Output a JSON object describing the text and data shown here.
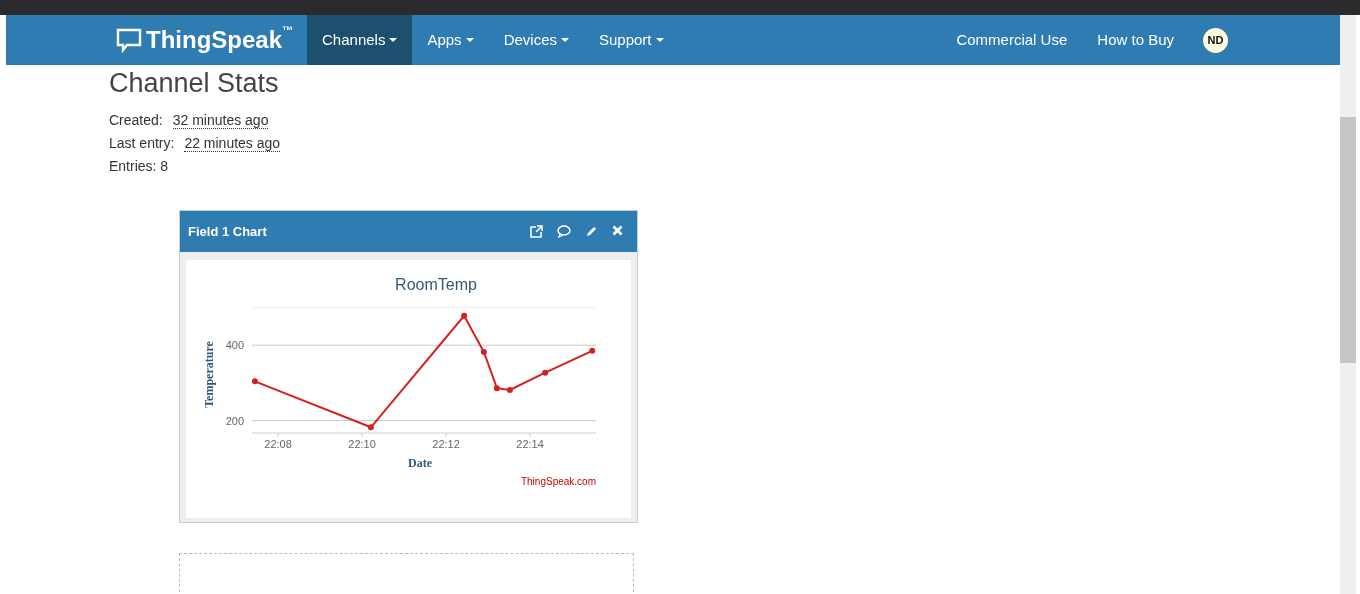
{
  "navbar": {
    "brand": "ThingSpeak",
    "trademark": "™",
    "menus": [
      {
        "label": "Channels",
        "selected": true,
        "kind": "dropdown"
      },
      {
        "label": "Apps",
        "selected": false,
        "kind": "dropdown"
      },
      {
        "label": "Devices",
        "selected": false,
        "kind": "dropdown"
      },
      {
        "label": "Support",
        "selected": false,
        "kind": "dropdown"
      }
    ],
    "links": [
      "Commercial Use",
      "How to Buy"
    ],
    "avatar": "ND"
  },
  "stats": {
    "title": "Channel Stats",
    "rows": [
      {
        "label": "Created:",
        "value": "32 minutes ago"
      },
      {
        "label": "Last entry:",
        "value": "22 minutes ago"
      },
      {
        "label": "Entries: 8"
      }
    ]
  },
  "widget": {
    "title": "Field 1 Chart",
    "chart_data": {
      "type": "line",
      "title": "RoomTemp",
      "xlabel": "Date",
      "ylabel": "Temperature",
      "x": [
        1327.45,
        1330.21,
        1332.43,
        1332.9,
        1333.21,
        1333.52,
        1334.36,
        1335.48
      ],
      "series": [
        {
          "color": "#d62020",
          "marker": "circle",
          "values": [
            304,
            182,
            478,
            382,
            286,
            281,
            327,
            385
          ]
        }
      ],
      "xlim": [
        1327.38,
        1335.57
      ],
      "ylim": [
        167,
        500
      ],
      "xticks": [
        {
          "value": 1328,
          "label": "22:08"
        },
        {
          "value": 1330,
          "label": "22:10"
        },
        {
          "value": 1332,
          "label": "22:12"
        },
        {
          "value": 1334,
          "label": "22:14"
        }
      ],
      "yticks": [
        200,
        400
      ]
    },
    "credit": "ThingSpeak.com"
  }
}
